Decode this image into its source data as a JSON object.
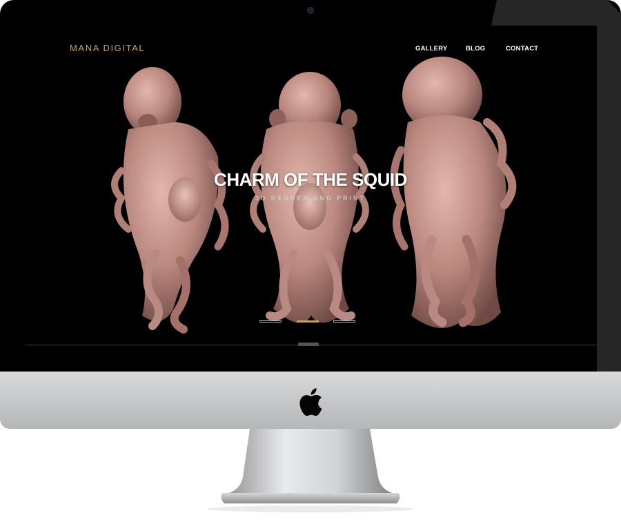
{
  "site": {
    "logo": "MANA DIGITAL",
    "nav": [
      "GALLERY",
      "BLOG",
      "CONTACT"
    ]
  },
  "hero": {
    "title": "CHARM OF THE SQUID",
    "subtitle": "3D RENDER AND PRINT",
    "slides": 3,
    "active_slide": 2
  },
  "colors": {
    "accent": "#c9a45a",
    "background": "#000000",
    "sculpture": "#c89a90"
  },
  "icons": [
    "apple-logo-icon",
    "camera-icon"
  ]
}
